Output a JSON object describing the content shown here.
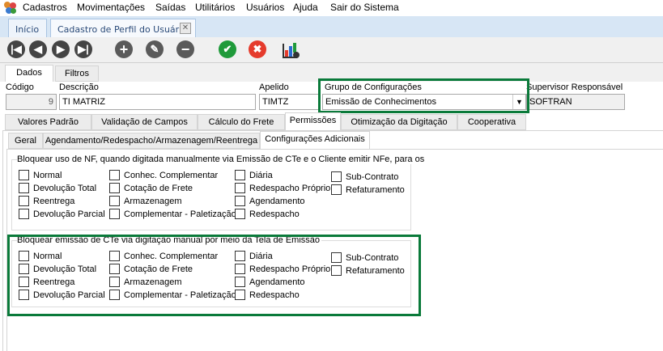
{
  "menu": [
    "Cadastros",
    "Movimentações",
    "Saídas",
    "Utilitários",
    "Usuários",
    "Ajuda",
    "Sair do Sistema"
  ],
  "doc_tabs": [
    {
      "label": "Início"
    },
    {
      "label": "Cadastro de Perfil do Usuário"
    }
  ],
  "toolbar": {
    "icons": [
      "first-icon",
      "previous-icon",
      "next-icon",
      "last-icon",
      "add-icon",
      "edit-icon",
      "remove-icon",
      "confirm-icon",
      "cancel-icon",
      "report-settings-icon"
    ]
  },
  "form_tabs": [
    "Dados",
    "Filtros"
  ],
  "fields": {
    "codigo": {
      "label": "Código",
      "value": "9"
    },
    "descricao": {
      "label": "Descrição",
      "value": "TI MATRIZ"
    },
    "apelido": {
      "label": "Apelido",
      "value": "TIMTZ"
    },
    "grupo": {
      "label": "Grupo de Configurações",
      "value": "Emissão de Conhecimentos"
    },
    "supervisor": {
      "label": "Supervisor Responsável",
      "value": "SOFTRAN"
    }
  },
  "section_tabs": [
    "Valores Padrão",
    "Validação de Campos",
    "Cálculo do Frete",
    "Permissões",
    "Otimização da Digitação",
    "Cooperativa"
  ],
  "sub_tabs": [
    "Geral",
    "Agendamento/Redespacho/Armazenagem/Reentrega",
    "Configurações Adicionais"
  ],
  "groups": [
    {
      "title": "Bloquear uso de NF, quando digitada manualmente via Emissão de CTe e o Cliente emitir NFe, para os",
      "columns": [
        [
          "Normal",
          "Devolução Total",
          "Reentrega",
          "Devolução Parcial"
        ],
        [
          "Conhec. Complementar",
          "Cotação de Frete",
          "Armazenagem",
          "Complementar - Paletização"
        ],
        [
          "Diária",
          "Redespacho Próprio",
          "Agendamento",
          "Redespacho"
        ],
        [
          "Sub-Contrato",
          "Refaturamento"
        ]
      ]
    },
    {
      "title": "Bloquear emissão de CTe via digitação manual por meio da Tela de Emissão",
      "columns": [
        [
          "Normal",
          "Devolução Total",
          "Reentrega",
          "Devolução Parcial"
        ],
        [
          "Conhec. Complementar",
          "Cotação de Frete",
          "Armazenagem",
          "Complementar - Paletização"
        ],
        [
          "Diária",
          "Redespacho Próprio",
          "Agendamento",
          "Redespacho"
        ],
        [
          "Sub-Contrato",
          "Refaturamento"
        ]
      ]
    }
  ],
  "colors": {
    "highlight": "#0a7a3a",
    "confirm": "#1f9a3a",
    "cancel": "#e53b2c"
  }
}
